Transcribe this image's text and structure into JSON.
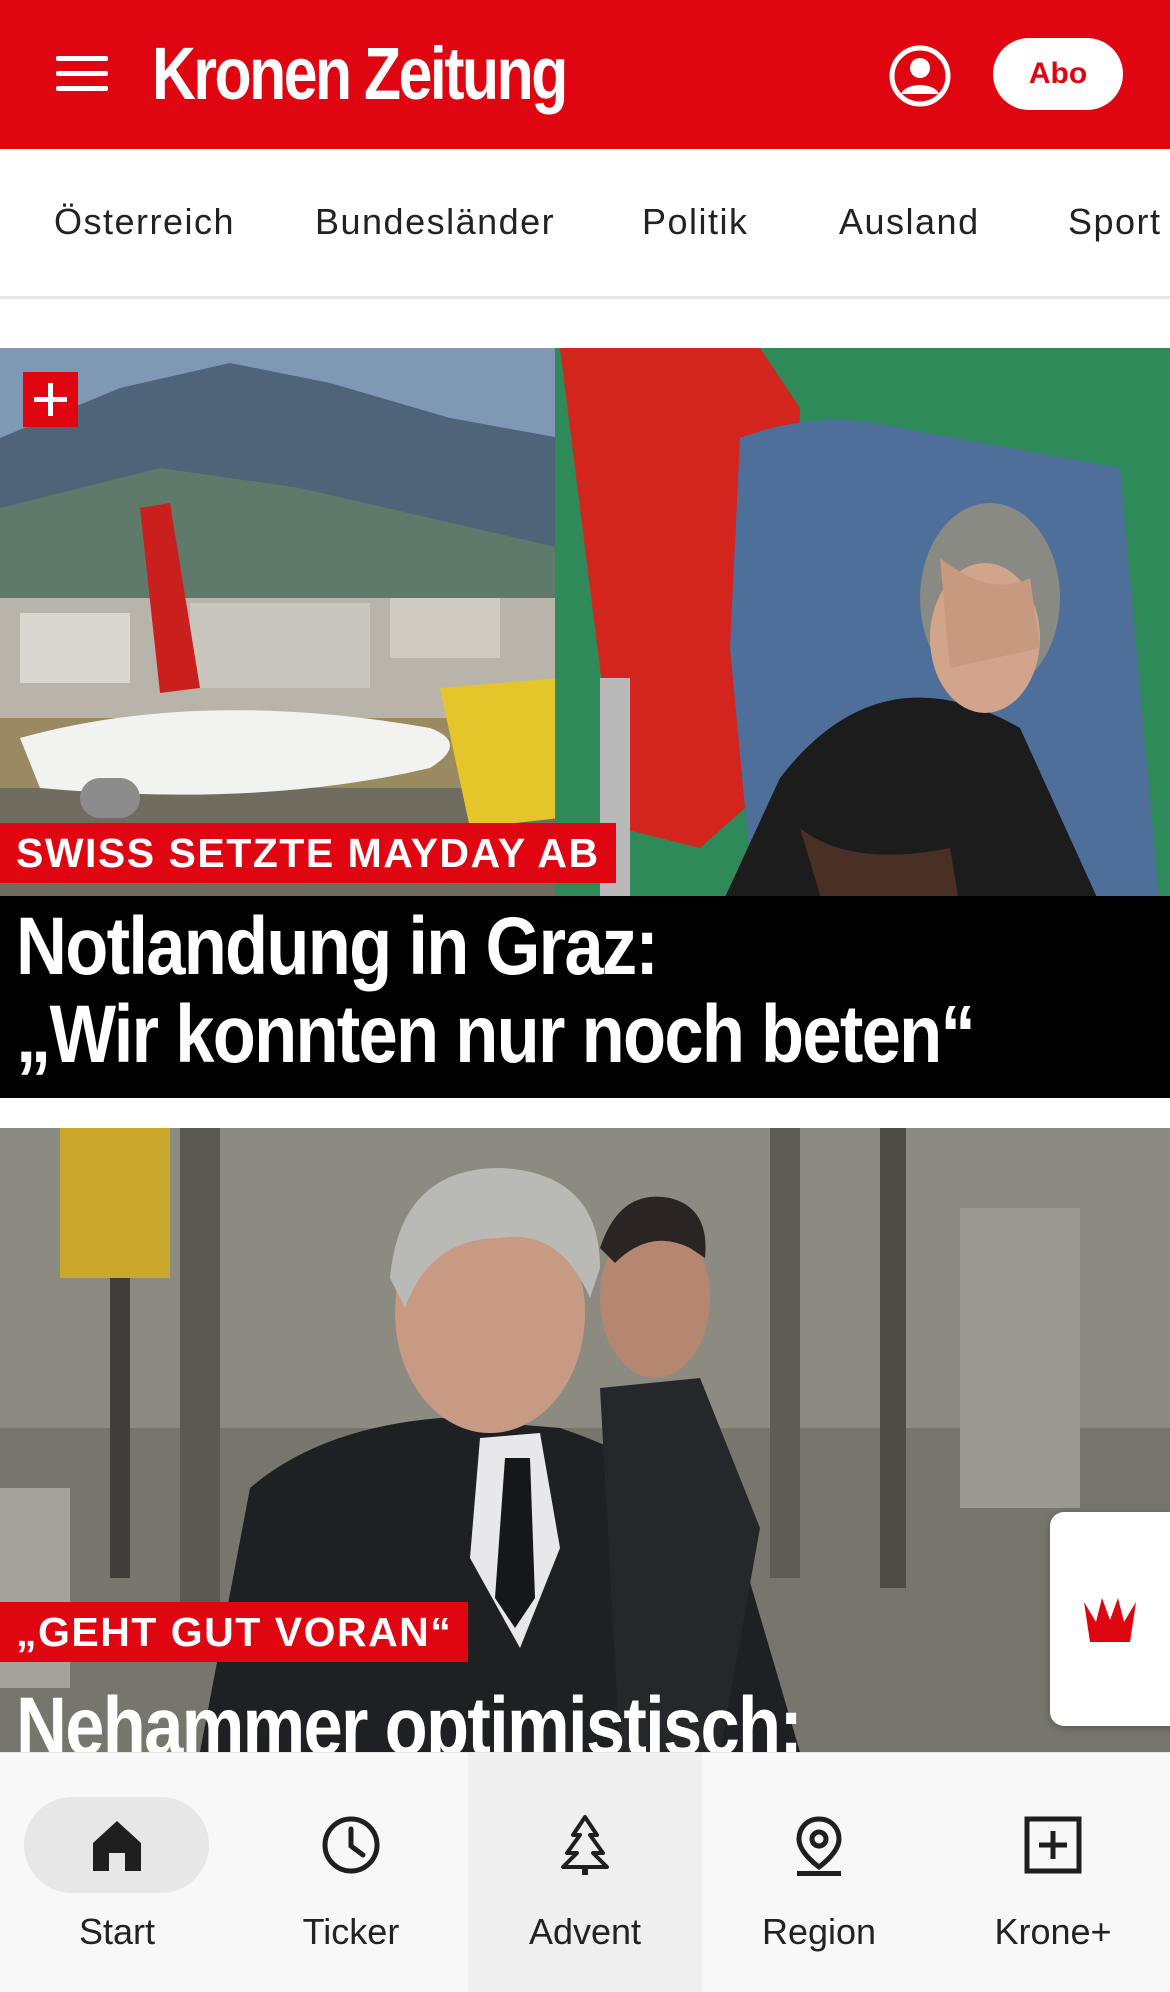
{
  "header": {
    "logo_text": "Kronen Zeitung",
    "abo_label": "Abo",
    "menu_icon": "hamburger-menu-icon",
    "account_icon": "user-account-icon",
    "brand_color": "#df0612"
  },
  "nav": {
    "items": [
      "Österreich",
      "Bundesländer",
      "Politik",
      "Ausland",
      "Sport"
    ]
  },
  "articles": [
    {
      "badge_icon": "krone-plus-icon",
      "kicker": "SWISS SETZTE MAYDAY AB",
      "headline_line1": "Notlandung in Graz:",
      "headline_line2": "„Wir konnten nur noch beten“"
    },
    {
      "kicker": "„GEHT GUT VORAN“",
      "headline_line1": "Nehammer optimistisch:"
    }
  ],
  "floating_widget": {
    "icon": "krone-crown-icon"
  },
  "bottom_nav": {
    "items": [
      {
        "label": "Start",
        "icon": "home-icon",
        "active": true
      },
      {
        "label": "Ticker",
        "icon": "clock-icon",
        "active": false
      },
      {
        "label": "Advent",
        "icon": "christmas-tree-icon",
        "active": false
      },
      {
        "label": "Region",
        "icon": "location-pin-icon",
        "active": false
      },
      {
        "label": "Krone+",
        "icon": "plus-square-icon",
        "active": false
      }
    ]
  }
}
